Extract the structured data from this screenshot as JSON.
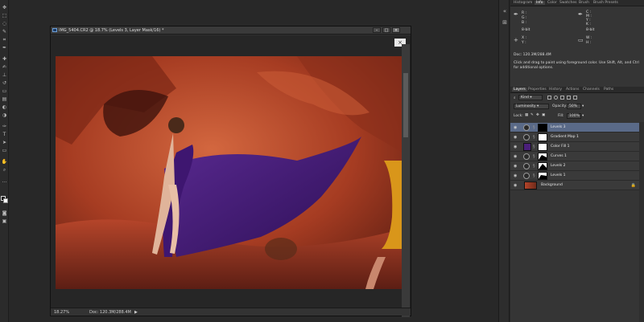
{
  "document": {
    "title": "IMG_5404.CR2 @ 18.7% (Levels 3, Layer Mask/16) *",
    "zoom": "18.27%",
    "doc_size": "Doc: 120.3M/288.4M",
    "minimize": "–",
    "restore": "□",
    "close": "×",
    "close_x": "×"
  },
  "panels": {
    "top_tabs": [
      "Histogram",
      "Info",
      "Color",
      "Swatches",
      "Brush",
      "Brush Presets"
    ],
    "active_top_tab": "Info",
    "info": {
      "row1_left": [
        "R :",
        "G :",
        "B :"
      ],
      "row1_left2": "8-bit",
      "row1_right": [
        "C :",
        "M :",
        "Y :",
        "K :"
      ],
      "row1_right2": "8-bit",
      "row2_left": [
        "X :",
        "Y :"
      ],
      "row2_right": [
        "W :",
        "H :"
      ],
      "doc": "Doc: 120.3M/288.4M",
      "hint": "Click and drag to paint using foreground color. Use Shift, Alt, and Ctrl for additional options."
    },
    "layer_tabs": [
      "Layers",
      "Properties",
      "History",
      "Actions",
      "Channels",
      "Paths"
    ],
    "active_layer_tab": "Layers",
    "kind_label": "Kind",
    "blend_mode": "Luminosity",
    "opacity_label": "Opacity:",
    "opacity_value": "50%",
    "lock_label": "Lock:",
    "fill_label": "Fill:",
    "fill_value": "100%",
    "layers": [
      {
        "name": "Levels 3",
        "type": "adjustment",
        "mask": "#000000",
        "selected": true
      },
      {
        "name": "Gradient Map 1",
        "type": "adjustment",
        "mask": "#ffffff",
        "selected": false
      },
      {
        "name": "Color Fill 1",
        "type": "fill",
        "fill": "#4a1f7a",
        "mask": "#ffffff",
        "selected": false
      },
      {
        "name": "Curves 1",
        "type": "adjustment",
        "mask": "#ffffff",
        "selected": false
      },
      {
        "name": "Levels 2",
        "type": "adjustment",
        "mask": "#ffffff",
        "selected": false
      },
      {
        "name": "Levels 1",
        "type": "adjustment",
        "mask": "#ffffff",
        "selected": false
      },
      {
        "name": "Background",
        "type": "pixel",
        "selected": false,
        "locked": true
      }
    ]
  },
  "colors": {
    "selected_layer": "#5a6a88",
    "fabric": "#4a1f7a",
    "rock": "#b5452a"
  }
}
